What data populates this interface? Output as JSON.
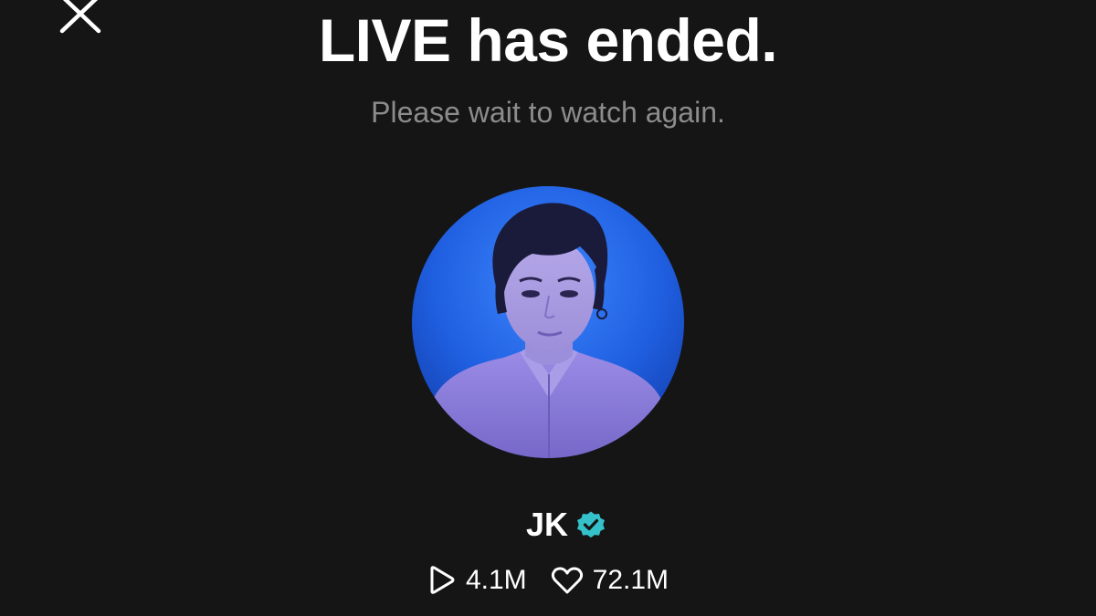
{
  "header": {
    "title": "LIVE has ended.",
    "subtitle": "Please wait to watch again."
  },
  "close": {
    "icon": "close-icon"
  },
  "profile": {
    "name": "JK",
    "verified": true,
    "verified_color": "#35c1c9",
    "avatar_background": "#1f5fe0"
  },
  "stats": {
    "views": "4.1M",
    "likes": "72.1M",
    "views_icon": "play-icon",
    "likes_icon": "heart-icon"
  },
  "colors": {
    "background": "#151515",
    "title": "#ffffff",
    "subtitle": "#8c8c8c"
  }
}
